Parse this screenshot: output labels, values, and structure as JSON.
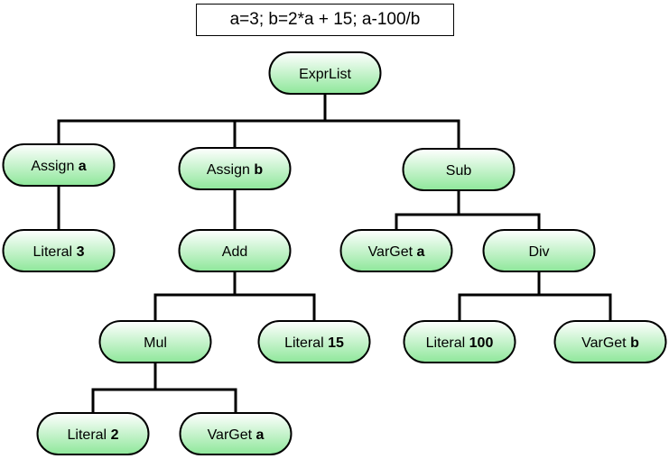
{
  "title": "a=3; b=2*a + 15; a-100/b",
  "colors": {
    "node_top": "#ffffff",
    "node_bottom": "#8ee79a",
    "stroke": "#000000"
  },
  "nodes": [
    {
      "id": "exprlist",
      "label": "ExprList",
      "bold": ""
    },
    {
      "id": "assign-a",
      "label": "Assign ",
      "bold": "a"
    },
    {
      "id": "assign-b",
      "label": "Assign ",
      "bold": "b"
    },
    {
      "id": "sub",
      "label": "Sub",
      "bold": ""
    },
    {
      "id": "literal-3",
      "label": "Literal ",
      "bold": "3"
    },
    {
      "id": "add",
      "label": "Add",
      "bold": ""
    },
    {
      "id": "varget-a-1",
      "label": "VarGet ",
      "bold": "a"
    },
    {
      "id": "div",
      "label": "Div",
      "bold": ""
    },
    {
      "id": "mul",
      "label": "Mul",
      "bold": ""
    },
    {
      "id": "literal-15",
      "label": "Literal ",
      "bold": "15"
    },
    {
      "id": "literal-100",
      "label": "Literal ",
      "bold": "100"
    },
    {
      "id": "varget-b",
      "label": "VarGet ",
      "bold": "b"
    },
    {
      "id": "literal-2",
      "label": "Literal ",
      "bold": "2"
    },
    {
      "id": "varget-a-2",
      "label": "VarGet ",
      "bold": "a"
    }
  ],
  "edges": [
    [
      "exprlist",
      [
        "assign-a",
        "assign-b",
        "sub"
      ]
    ],
    [
      "assign-a",
      [
        "literal-3"
      ]
    ],
    [
      "assign-b",
      [
        "add"
      ]
    ],
    [
      "sub",
      [
        "varget-a-1",
        "div"
      ]
    ],
    [
      "add",
      [
        "mul",
        "literal-15"
      ]
    ],
    [
      "div",
      [
        "literal-100",
        "varget-b"
      ]
    ],
    [
      "mul",
      [
        "literal-2",
        "varget-a-2"
      ]
    ]
  ]
}
